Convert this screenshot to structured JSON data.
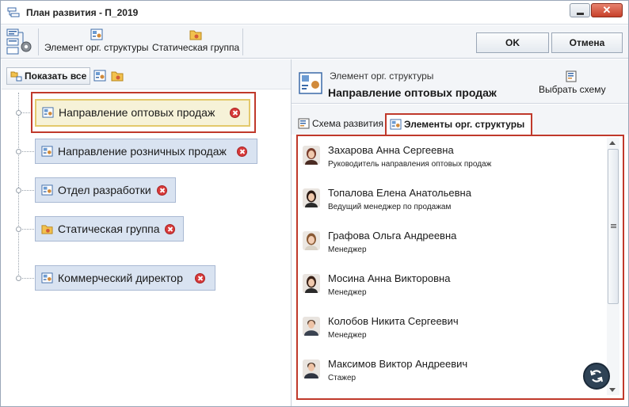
{
  "window": {
    "title": "План развития - П_2019"
  },
  "toolbar": {
    "org_element_label": "Элемент орг. структуры",
    "static_group_label": "Статическая группа",
    "ok_label": "OK",
    "cancel_label": "Отмена"
  },
  "left_pane": {
    "show_all_label": "Показать все",
    "nodes": [
      {
        "label": "Направление оптовых продаж",
        "icon": "org-element-icon",
        "selected": true
      },
      {
        "label": "Направление розничных продаж",
        "icon": "org-element-icon",
        "selected": false
      },
      {
        "label": "Отдел разработки",
        "icon": "org-element-icon",
        "selected": false
      },
      {
        "label": "Статическая группа",
        "icon": "folder-group-icon",
        "selected": false
      },
      {
        "label": "Коммерческий директор",
        "icon": "org-element-icon",
        "selected": false
      }
    ]
  },
  "right_pane": {
    "caption": "Элемент орг. структуры",
    "name": "Направление оптовых продаж",
    "choose_scheme_label": "Выбрать схему",
    "tabs": [
      {
        "label": "Схема развития",
        "active": false
      },
      {
        "label": "Элементы орг. структуры",
        "active": true
      }
    ],
    "people": [
      {
        "name": "Захарова Анна Сергеевна",
        "role": "Руководитель направления оптовых продаж",
        "gender": "female"
      },
      {
        "name": "Топалова Елена Анатольевна",
        "role": "Ведущий менеджер по продажам",
        "gender": "female"
      },
      {
        "name": "Графова Ольга Андреевна",
        "role": "Менеджер",
        "gender": "female"
      },
      {
        "name": "Мосина Анна Викторовна",
        "role": "Менеджер",
        "gender": "female"
      },
      {
        "name": "Колобов Никита Сергеевич",
        "role": "Менеджер",
        "gender": "male"
      },
      {
        "name": "Максимов Виктор Андреевич",
        "role": "Стажер",
        "gender": "male"
      }
    ]
  },
  "colors": {
    "highlight_red": "#c0392b",
    "node_fill": "#d9e3f1",
    "node_border": "#a9b9d3",
    "selected_fill": "#f6f2d8",
    "toolbar_bg": "#f3f5f8"
  }
}
